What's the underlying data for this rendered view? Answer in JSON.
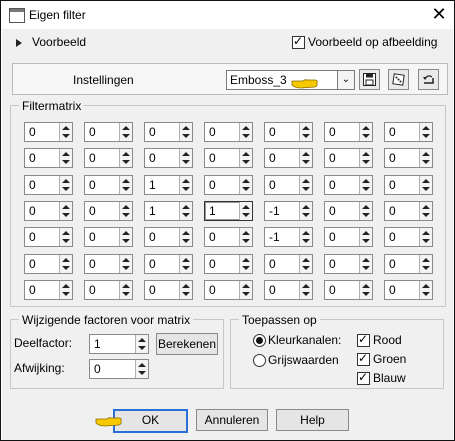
{
  "window": {
    "title": "Eigen filter",
    "close_glyph": "✕"
  },
  "preview": {
    "label": "Voorbeeld",
    "on_image_label": "Voorbeeld op afbeelding",
    "on_image_checked": true
  },
  "settings": {
    "label": "Instellingen",
    "preset_value": "Emboss_3",
    "preset_arrow": "⌄"
  },
  "matrix": {
    "label": "Filtermatrix",
    "rows": [
      [
        "0",
        "0",
        "0",
        "0",
        "0",
        "0",
        "0"
      ],
      [
        "0",
        "0",
        "0",
        "0",
        "0",
        "0",
        "0"
      ],
      [
        "0",
        "0",
        "1",
        "0",
        "0",
        "0",
        "0"
      ],
      [
        "0",
        "0",
        "1",
        "1",
        "-1",
        "0",
        "0"
      ],
      [
        "0",
        "0",
        "0",
        "0",
        "-1",
        "0",
        "0"
      ],
      [
        "0",
        "0",
        "0",
        "0",
        "0",
        "0",
        "0"
      ],
      [
        "0",
        "0",
        "0",
        "0",
        "0",
        "0",
        "0"
      ]
    ]
  },
  "factors": {
    "label": "Wijzigende factoren voor matrix",
    "divisor_label": "Deelfactor:",
    "divisor_value": "1",
    "compute_label": "Berekenen",
    "bias_label": "Afwijking:",
    "bias_value": "0"
  },
  "apply": {
    "label": "Toepassen op",
    "color_channels_label": "Kleurkanalen:",
    "grayscale_label": "Grijswaarden",
    "red_label": "Rood",
    "green_label": "Groen",
    "blue_label": "Blauw"
  },
  "buttons": {
    "ok": "OK",
    "cancel": "Annuleren",
    "help": "Help"
  },
  "colors": {
    "dialog_bg": "#f0f0f0",
    "default_button_border": "#2a6fd6",
    "pointer_hand": "#f5c800"
  }
}
